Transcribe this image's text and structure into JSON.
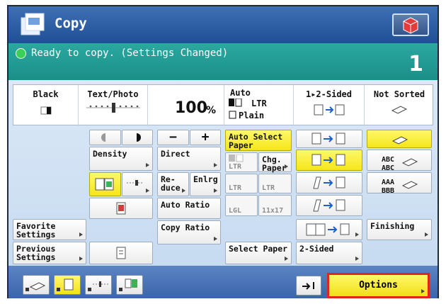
{
  "title": "Copy",
  "status": {
    "text": "Ready to copy. (Settings Changed)",
    "count": "1"
  },
  "summary": {
    "color": "Black",
    "image_quality": "Text/Photo",
    "zoom": "100",
    "zoom_unit": "%",
    "paper_mode": "Auto",
    "paper_size": "LTR",
    "paper_type": "Plain",
    "sided": "1▸2-Sided",
    "finishing": "Not Sorted"
  },
  "buttons": {
    "auto_select_paper": "Auto Select Paper",
    "density": "Density",
    "direct": "Direct",
    "reduce": "Re-\nduce",
    "enlarge": "Enlrg",
    "auto_ratio": "Auto Ratio",
    "copy_ratio": "Copy Ratio",
    "chg_paper": "Chg. Paper",
    "ltr": "LTR",
    "lgl": "LGL",
    "p11x17": "11x17",
    "favorite": "Favorite Settings",
    "previous": "Previous Settings",
    "select_paper": "Select Paper",
    "two_sided": "2-Sided",
    "finishing": "Finishing",
    "minus": "−",
    "plus": "+",
    "abc": "ABC ABC",
    "aaa": "AAA BBB",
    "options": "Options"
  }
}
